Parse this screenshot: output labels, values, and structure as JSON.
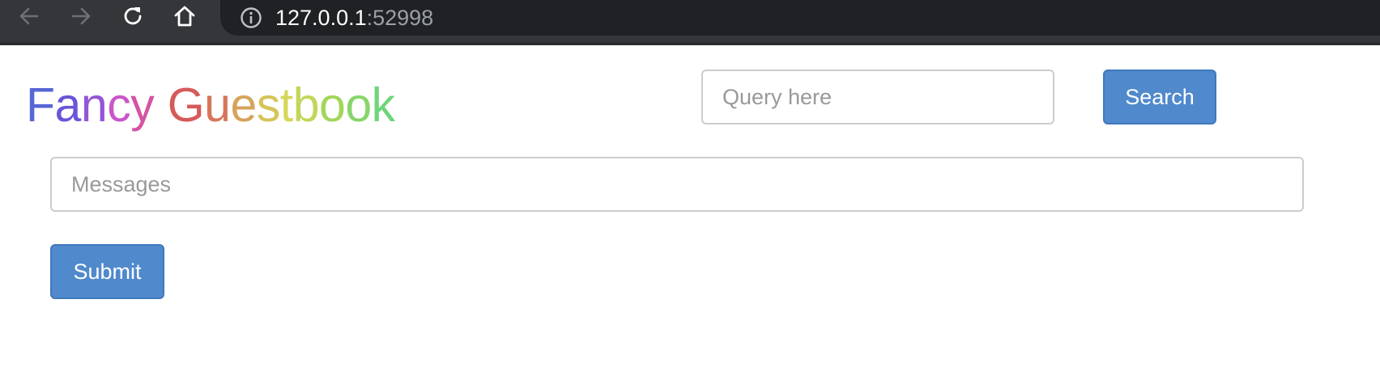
{
  "browser": {
    "url_host": "127.0.0.1",
    "url_port": ":52998",
    "icons": [
      "back-arrow-icon",
      "forward-arrow-icon",
      "reload-icon",
      "home-icon",
      "info-icon"
    ]
  },
  "header": {
    "brand_letters": [
      "F",
      "a",
      "n",
      "c",
      "y",
      " ",
      "G",
      "u",
      "e",
      "s",
      "t",
      "b",
      "o",
      "o",
      "k"
    ],
    "brand_colors": [
      "#5865d6",
      "#6a55d8",
      "#9456d6",
      "#c957c8",
      "#d454a2",
      "#ffffff",
      "#d65a5a",
      "#d6765a",
      "#d6a35a",
      "#d6c45a",
      "#d6d65a",
      "#c2d65a",
      "#a2d65a",
      "#86d66a",
      "#6fd67a"
    ]
  },
  "search": {
    "placeholder": "Query here",
    "button_label": "Search"
  },
  "guestbook": {
    "messages_placeholder": "Messages",
    "submit_label": "Submit"
  },
  "theme": {
    "primary_button": "#5089cc",
    "chrome_bg": "#35363a",
    "omnibox_bg": "#202124"
  }
}
